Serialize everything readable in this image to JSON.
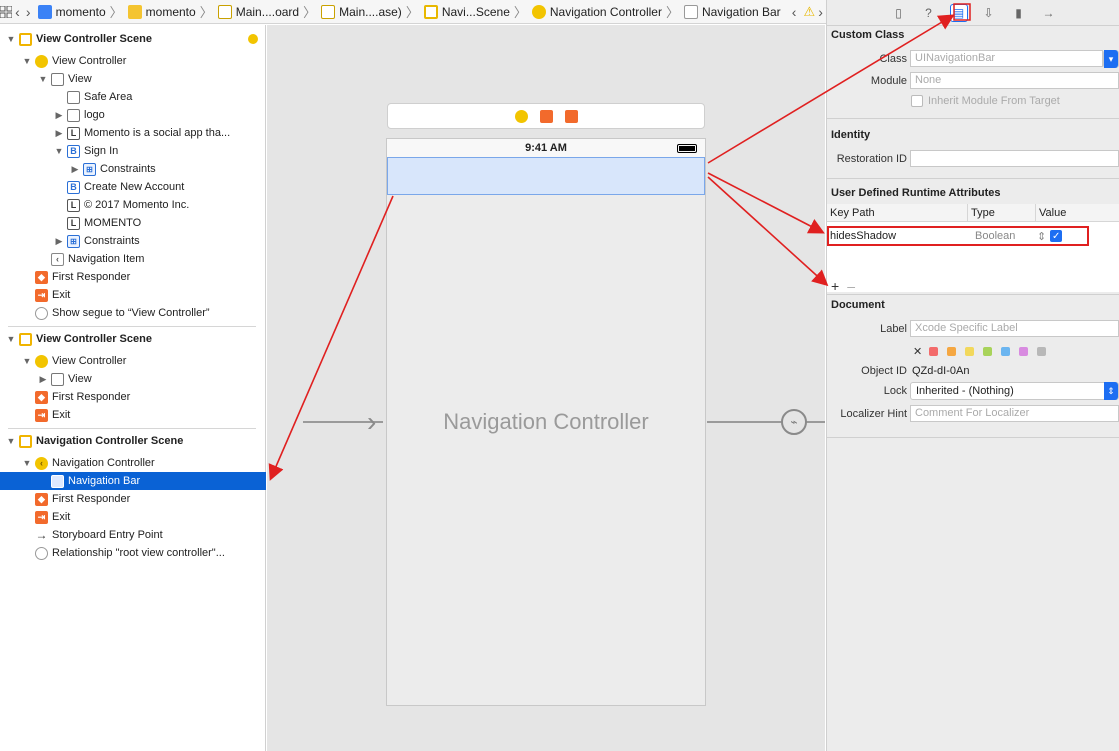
{
  "jumpbar": {
    "crumbs": [
      "momento",
      "momento",
      "Main....oard",
      "Main....ase)",
      "Navi...Scene",
      "Navigation Controller",
      "Navigation Bar"
    ]
  },
  "outline": {
    "scene1": {
      "title": "View Controller Scene",
      "view_controller": "View Controller",
      "view": "View",
      "safe_area": "Safe Area",
      "logo": "logo",
      "label_momento": "Momento is a social app tha...",
      "sign_in": "Sign In",
      "constraints_inner": "Constraints",
      "create_account": "Create New Account",
      "copyright": "© 2017 Momento Inc.",
      "momento_label": "MOMENTO",
      "constraints": "Constraints",
      "navigation_item": "Navigation Item",
      "first_responder": "First Responder",
      "exit": "Exit",
      "segue": "Show segue to “View Controller”"
    },
    "scene2": {
      "title": "View Controller Scene",
      "view_controller": "View Controller",
      "view": "View",
      "first_responder": "First Responder",
      "exit": "Exit"
    },
    "scene3": {
      "title": "Navigation Controller Scene",
      "navigation_controller": "Navigation Controller",
      "navigation_bar": "Navigation Bar",
      "first_responder": "First Responder",
      "exit": "Exit",
      "entry_point": "Storyboard Entry Point",
      "relationship": "Relationship \"root view controller\"..."
    }
  },
  "canvas": {
    "status_time": "9:41 AM",
    "vc_title": "Navigation Controller"
  },
  "inspector": {
    "custom_class": {
      "title": "Custom Class",
      "class_label": "Class",
      "class_placeholder": "UINavigationBar",
      "module_label": "Module",
      "module_value": "None",
      "inherit_label": "Inherit Module From Target"
    },
    "identity": {
      "title": "Identity",
      "restoration_label": "Restoration ID",
      "restoration_value": ""
    },
    "udra": {
      "title": "User Defined Runtime Attributes",
      "col_key": "Key Path",
      "col_type": "Type",
      "col_value": "Value",
      "row_key": "hidesShadow",
      "row_type": "Boolean",
      "row_checked": true,
      "add_symbol": "+",
      "remove_symbol": "–"
    },
    "document": {
      "title": "Document",
      "label_label": "Label",
      "label_placeholder": "Xcode Specific Label",
      "clear_symbol": "✕",
      "object_id_label": "Object ID",
      "object_id_value": "QZd-dI-0An",
      "lock_label": "Lock",
      "lock_value": "Inherited - (Nothing)",
      "hint_label": "Localizer Hint",
      "hint_placeholder": "Comment For Localizer"
    }
  },
  "colors": {
    "selection": "#0a62d5",
    "accent": "#1d6ef2",
    "annotation": "#e02020",
    "swatches": [
      "#f36b6b",
      "#f5a742",
      "#f2d85c",
      "#a8d35a",
      "#6bb5f0",
      "#d88be0",
      "#b8b8b8"
    ]
  }
}
